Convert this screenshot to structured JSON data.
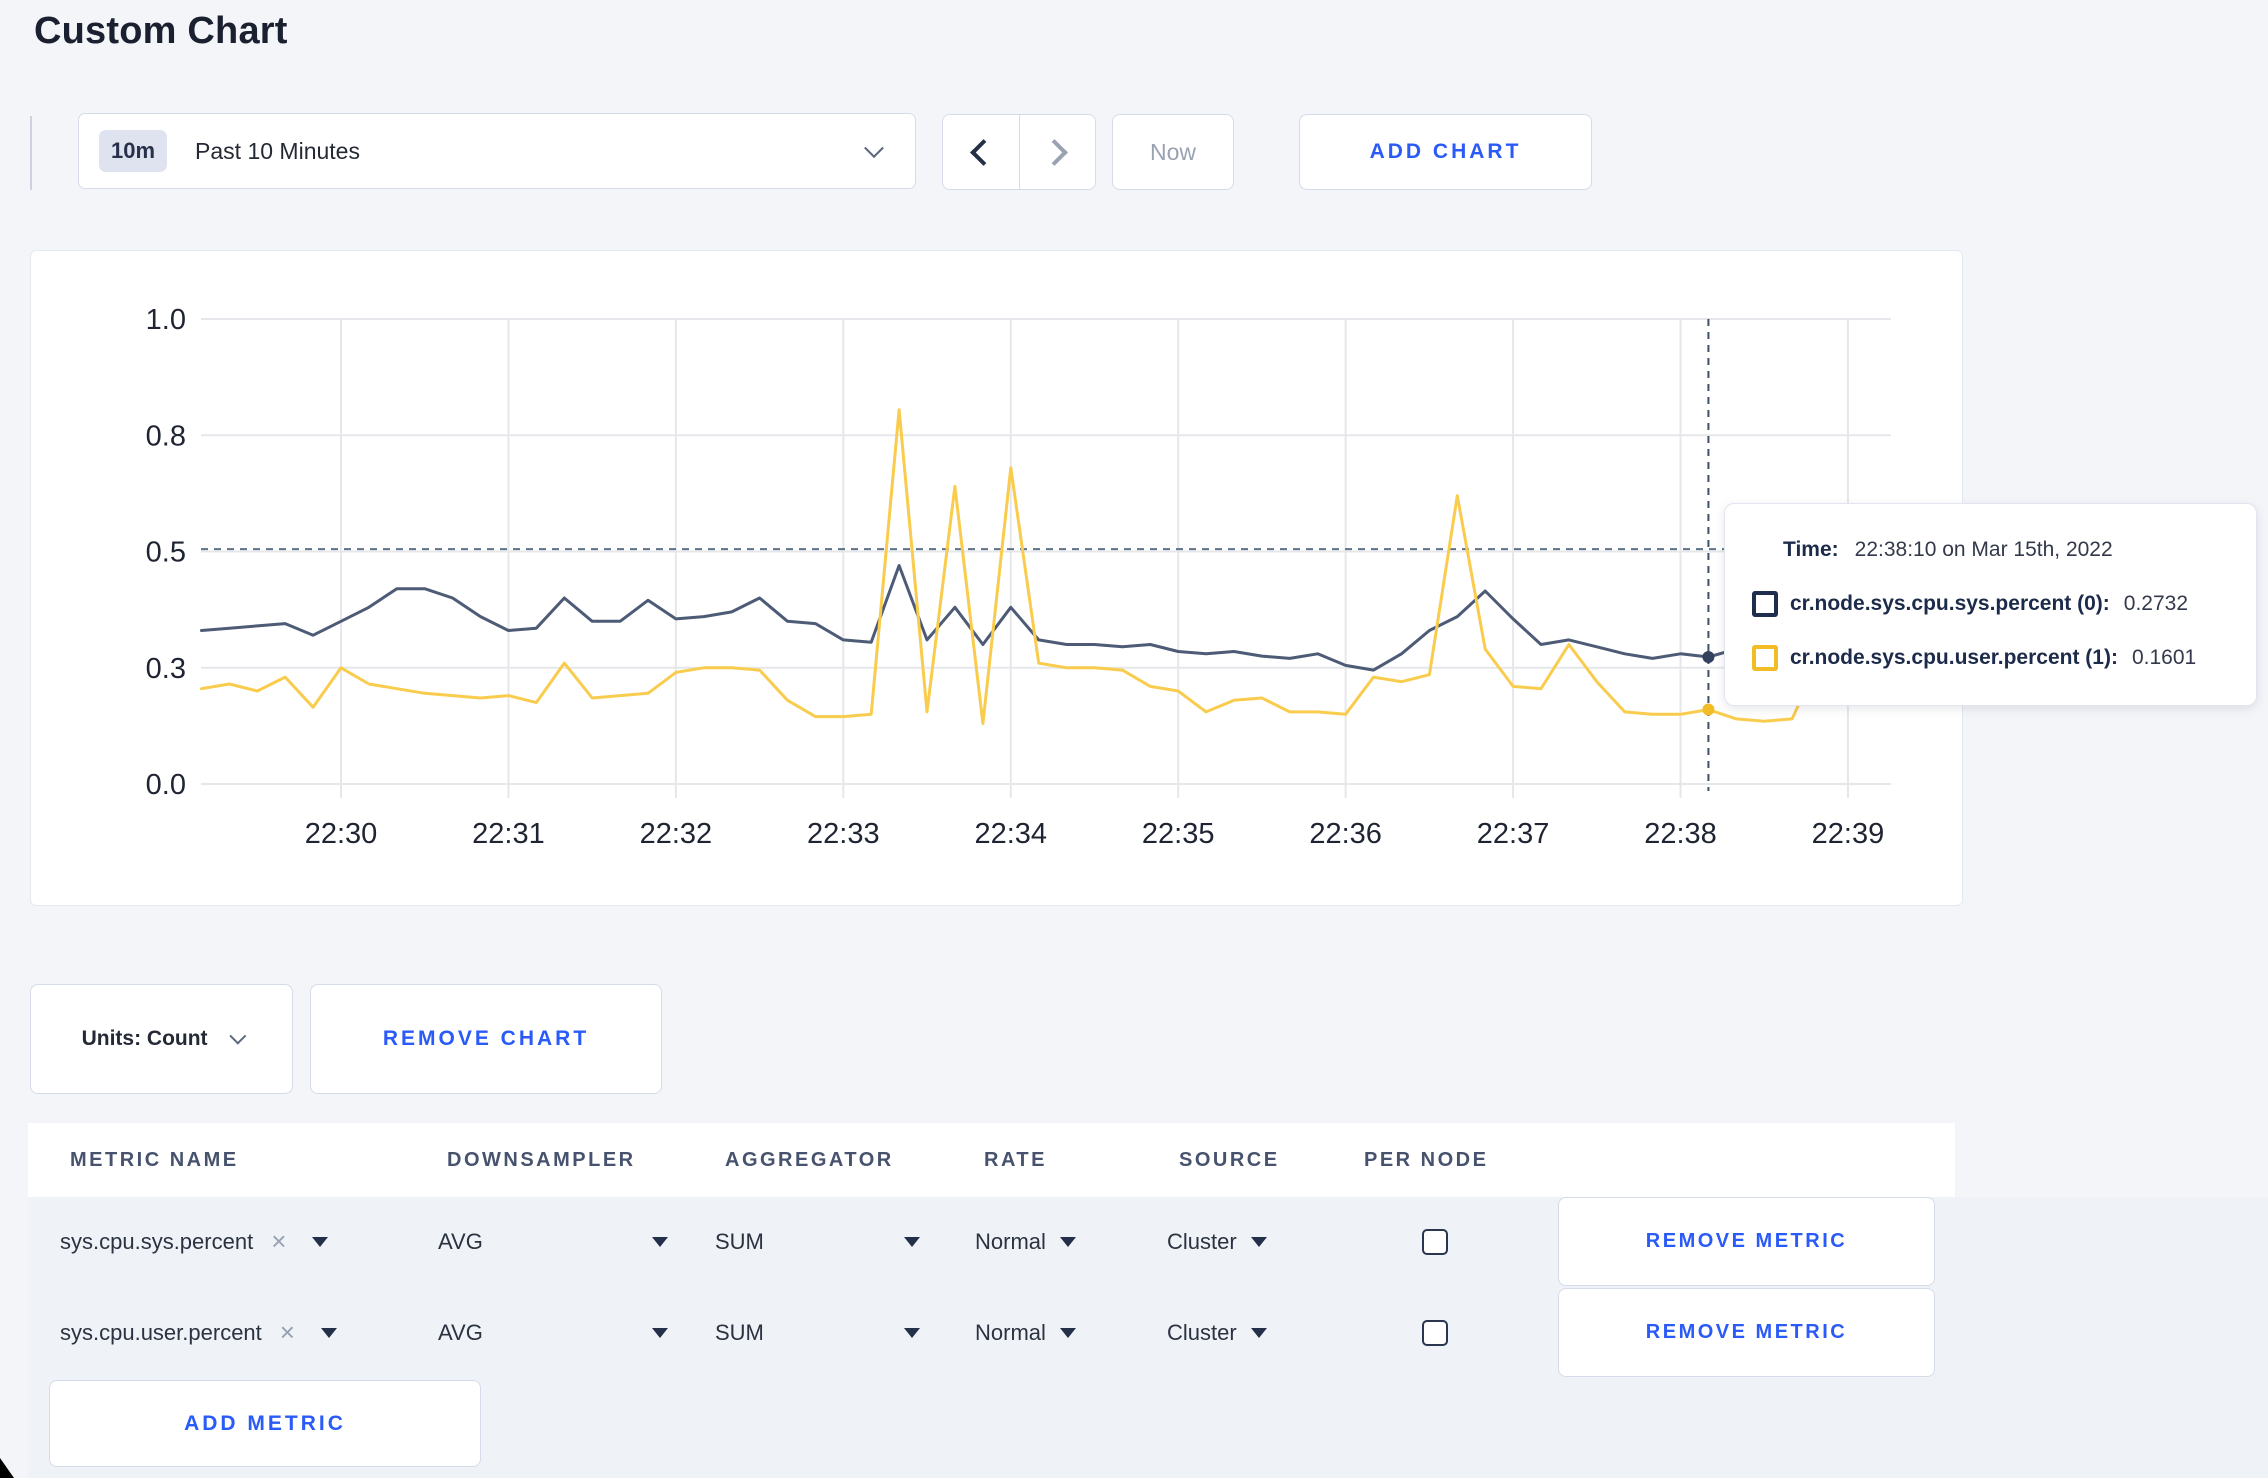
{
  "page": {
    "title": "Custom Chart"
  },
  "toolbar": {
    "time_badge": "10m",
    "time_label": "Past 10 Minutes",
    "now_label": "Now",
    "add_chart_label": "ADD CHART"
  },
  "chart_controls": {
    "units_label": "Units: Count",
    "remove_chart_label": "REMOVE CHART"
  },
  "tooltip": {
    "time_label": "Time:",
    "time_value": "22:38:10 on Mar 15th, 2022",
    "series": [
      {
        "name": "cr.node.sys.cpu.sys.percent (0):",
        "value": "0.2732",
        "swatch_color": "#1f2d4f"
      },
      {
        "name": "cr.node.sys.cpu.user.percent (1):",
        "value": "0.1601",
        "swatch_color": "#f1bc25"
      }
    ]
  },
  "chart_data": {
    "type": "line",
    "title": "",
    "xlabel": "",
    "ylabel": "",
    "ylim": [
      0,
      1
    ],
    "grid": true,
    "x_tick_labels": [
      "22:30",
      "22:31",
      "22:32",
      "22:33",
      "22:34",
      "22:35",
      "22:36",
      "22:37",
      "22:38",
      "22:39"
    ],
    "y_tick_values": [
      0,
      0.25,
      0.5,
      0.75,
      1.0
    ],
    "y_tick_labels": [
      "0.0",
      "0.3",
      "0.5",
      "0.8",
      "1.0"
    ],
    "start_time": "22:29:10",
    "end_time": "22:39:10",
    "interval_seconds": 10,
    "crosshair_time": "22:38:10",
    "crosshair_hline_value": 0.505,
    "legend_position": "tooltip",
    "series": [
      {
        "name": "cr.node.sys.cpu.sys.percent",
        "color": "#4d5b76",
        "marker_color": "#33415f",
        "marker_value": 0.2732,
        "values": [
          0.33,
          0.335,
          0.34,
          0.345,
          0.32,
          0.35,
          0.38,
          0.42,
          0.42,
          0.4,
          0.36,
          0.33,
          0.335,
          0.4,
          0.35,
          0.35,
          0.395,
          0.355,
          0.36,
          0.37,
          0.4,
          0.35,
          0.345,
          0.31,
          0.305,
          0.47,
          0.31,
          0.38,
          0.3,
          0.38,
          0.31,
          0.3,
          0.3,
          0.295,
          0.3,
          0.285,
          0.28,
          0.285,
          0.275,
          0.27,
          0.28,
          0.255,
          0.245,
          0.28,
          0.33,
          0.36,
          0.415,
          0.355,
          0.3,
          0.31,
          0.295,
          0.28,
          0.27,
          0.28,
          0.2732,
          0.29,
          0.31,
          0.3,
          0.295,
          0.31,
          0.295
        ]
      },
      {
        "name": "cr.node.sys.cpu.user.percent",
        "color": "#f9cc4e",
        "marker_color": "#f1bc25",
        "marker_value": 0.1601,
        "values": [
          0.205,
          0.215,
          0.2,
          0.23,
          0.165,
          0.25,
          0.215,
          0.205,
          0.195,
          0.19,
          0.185,
          0.19,
          0.175,
          0.26,
          0.185,
          0.19,
          0.195,
          0.24,
          0.25,
          0.25,
          0.245,
          0.18,
          0.145,
          0.145,
          0.15,
          0.805,
          0.155,
          0.64,
          0.13,
          0.68,
          0.26,
          0.25,
          0.25,
          0.245,
          0.21,
          0.2,
          0.155,
          0.18,
          0.185,
          0.155,
          0.155,
          0.15,
          0.23,
          0.22,
          0.235,
          0.62,
          0.29,
          0.21,
          0.205,
          0.3,
          0.22,
          0.155,
          0.15,
          0.15,
          0.1601,
          0.14,
          0.135,
          0.14,
          0.27,
          0.26,
          0.22
        ]
      }
    ]
  },
  "metrics_table": {
    "headers": [
      "METRIC NAME",
      "DOWNSAMPLER",
      "AGGREGATOR",
      "RATE",
      "SOURCE",
      "PER NODE"
    ],
    "rows": [
      {
        "metric": "sys.cpu.sys.percent",
        "downsampler": "AVG",
        "aggregator": "SUM",
        "rate": "Normal",
        "source": "Cluster",
        "per_node_checked": false,
        "remove_label": "REMOVE METRIC"
      },
      {
        "metric": "sys.cpu.user.percent",
        "downsampler": "AVG",
        "aggregator": "SUM",
        "rate": "Normal",
        "source": "Cluster",
        "per_node_checked": false,
        "remove_label": "REMOVE METRIC"
      }
    ],
    "add_metric_label": "ADD METRIC"
  },
  "colors": {
    "accent_blue": "#2a5af7",
    "page_background": "#f3f5f9",
    "panel_background": "#eff2f7",
    "gridline": "#e6e7ea",
    "crosshair": "#3f5068",
    "threshold_dash": "#5d7287"
  }
}
